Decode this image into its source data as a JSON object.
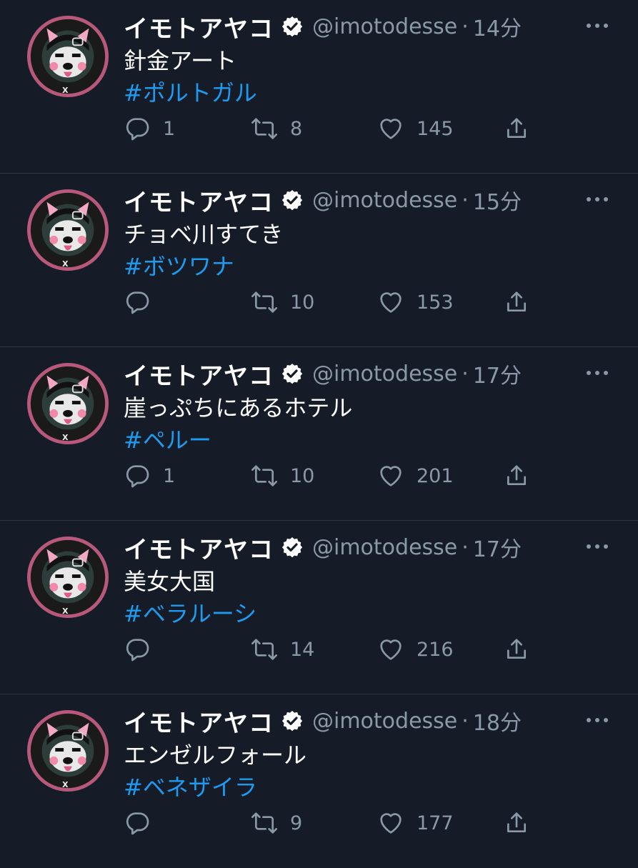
{
  "icons": {
    "avatar": "avatar-illustration",
    "verified": "verified-badge-icon",
    "more": "more-options-icon",
    "reply": "reply-icon",
    "retweet": "retweet-icon",
    "like": "heart-icon",
    "share": "share-icon"
  },
  "colors": {
    "background": "#151c27",
    "divider": "#2f3943",
    "text": "#ffffff",
    "muted": "#8b98a5",
    "hashtag": "#1d9bf0"
  },
  "separator": "·",
  "tweets": [
    {
      "name": "イモトアヤコ",
      "handle": "@imotodesse",
      "time": "14分",
      "text": "針金アート",
      "hashtag": "#ポルトガル",
      "replies": "1",
      "retweets": "8",
      "likes": "145"
    },
    {
      "name": "イモトアヤコ",
      "handle": "@imotodesse",
      "time": "15分",
      "text": "チョベ川すてき",
      "hashtag": "#ボツワナ",
      "replies": "",
      "retweets": "10",
      "likes": "153"
    },
    {
      "name": "イモトアヤコ",
      "handle": "@imotodesse",
      "time": "17分",
      "text": "崖っぷちにあるホテル",
      "hashtag": "#ペルー",
      "replies": "1",
      "retweets": "10",
      "likes": "201"
    },
    {
      "name": "イモトアヤコ",
      "handle": "@imotodesse",
      "time": "17分",
      "text": "美女大国",
      "hashtag": "#ベラルーシ",
      "replies": "",
      "retweets": "14",
      "likes": "216"
    },
    {
      "name": "イモトアヤコ",
      "handle": "@imotodesse",
      "time": "18分",
      "text": "エンゼルフォール",
      "hashtag": "#ベネザイラ",
      "replies": "",
      "retweets": "9",
      "likes": "177"
    }
  ]
}
